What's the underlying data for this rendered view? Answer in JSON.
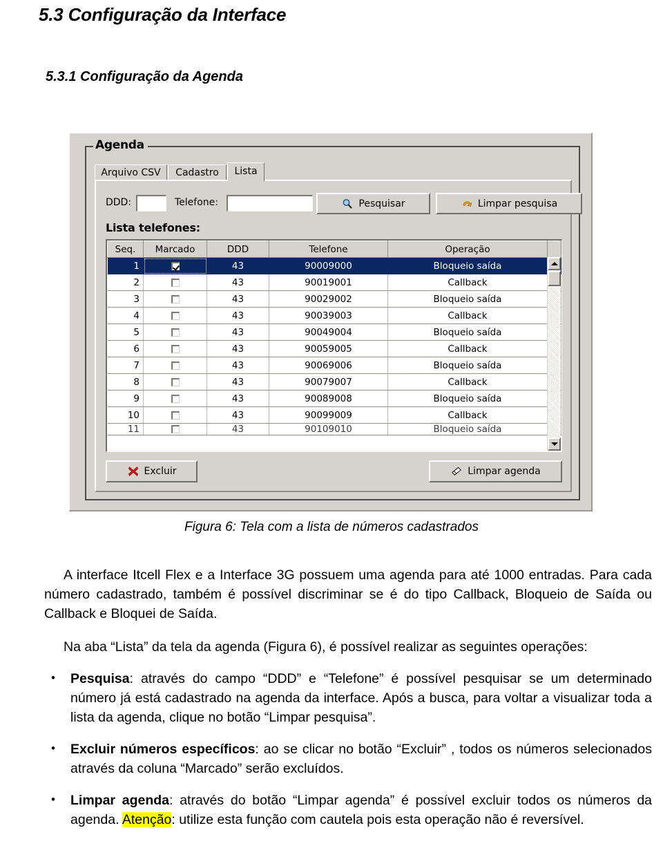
{
  "headings": {
    "section": "5.3 Configuração da Interface",
    "subsection": "5.3.1 Configuração da Agenda"
  },
  "figure": {
    "caption": "Figura 6: Tela com a lista de números cadastrados",
    "groupbox_title": "Agenda",
    "tabs": [
      {
        "label": "Arquivo CSV",
        "selected": false
      },
      {
        "label": "Cadastro",
        "selected": false
      },
      {
        "label": "Lista",
        "selected": true
      }
    ],
    "search": {
      "ddd_label": "DDD:",
      "ddd_value": "",
      "telefone_label": "Telefone:",
      "telefone_value": "",
      "search_button": "Pesquisar",
      "search_icon": "magnifier-icon",
      "clear_button": "Limpar pesquisa",
      "clear_icon": "undo-arrow-icon"
    },
    "list_label": "Lista telefones:",
    "grid": {
      "columns": [
        "Seq.",
        "Marcado",
        "DDD",
        "Telefone",
        "Operação"
      ],
      "rows": [
        {
          "seq": "1",
          "marcado": true,
          "ddd": "43",
          "telefone": "90009000",
          "operacao": "Bloqueio saída",
          "selected": true
        },
        {
          "seq": "2",
          "marcado": false,
          "ddd": "43",
          "telefone": "90019001",
          "operacao": "Callback",
          "selected": false
        },
        {
          "seq": "3",
          "marcado": false,
          "ddd": "43",
          "telefone": "90029002",
          "operacao": "Bloqueio saída",
          "selected": false
        },
        {
          "seq": "4",
          "marcado": false,
          "ddd": "43",
          "telefone": "90039003",
          "operacao": "Callback",
          "selected": false
        },
        {
          "seq": "5",
          "marcado": false,
          "ddd": "43",
          "telefone": "90049004",
          "operacao": "Bloqueio saída",
          "selected": false
        },
        {
          "seq": "6",
          "marcado": false,
          "ddd": "43",
          "telefone": "90059005",
          "operacao": "Callback",
          "selected": false
        },
        {
          "seq": "7",
          "marcado": false,
          "ddd": "43",
          "telefone": "90069006",
          "operacao": "Bloqueio saída",
          "selected": false
        },
        {
          "seq": "8",
          "marcado": false,
          "ddd": "43",
          "telefone": "90079007",
          "operacao": "Callback",
          "selected": false
        },
        {
          "seq": "9",
          "marcado": false,
          "ddd": "43",
          "telefone": "90089008",
          "operacao": "Bloqueio saída",
          "selected": false
        },
        {
          "seq": "10",
          "marcado": false,
          "ddd": "43",
          "telefone": "90099009",
          "operacao": "Callback",
          "selected": false
        },
        {
          "seq": "11",
          "marcado": false,
          "ddd": "43",
          "telefone": "90109010",
          "operacao": "Bloqueio saída",
          "selected": false,
          "partial": true
        }
      ]
    },
    "footer": {
      "delete_button": "Excluir",
      "delete_icon": "red-x-icon",
      "clear_agenda_button": "Limpar agenda",
      "clear_agenda_icon": "eraser-icon"
    },
    "scrollbar": {
      "up_icon": "scroll-up-arrow-icon",
      "down_icon": "scroll-down-arrow-icon"
    }
  },
  "body": {
    "para1": "A interface Itcell Flex e a Interface 3G possuem  uma agenda para até 1000 entradas. Para cada número cadastrado, também é possível discriminar se é do tipo Callback, Bloqueio de Saída ou Callback e Bloquei de Saída.",
    "para2": "Na aba “Lista” da tela da agenda (Figura 6), é possível realizar as seguintes operações:",
    "bullets": [
      {
        "term": "Pesquisa",
        "text": ":  através do campo “DDD” e “Telefone”  é possível pesquisar se um determinado número já está cadastrado na agenda da interface.  Após a busca, para voltar a visualizar toda a lista da agenda, clique no botão “Limpar pesquisa”."
      },
      {
        "term": "Excluir números específicos",
        "text": ":  ao se clicar no botão “Excluir” , todos os números selecionados através da coluna “Marcado” serão excluídos."
      },
      {
        "term": "Limpar agenda",
        "text_before_highlight": ":  através do botão “Limpar agenda” é possível excluir todos os números da agenda. ",
        "highlight": "Atenção",
        "text_after_highlight": ": utilize esta função com cautela pois esta operação não é reversível."
      }
    ]
  },
  "colors": {
    "selection": "#0b2763",
    "highlight": "#ffff00",
    "window_face": "#d6d3ce"
  }
}
